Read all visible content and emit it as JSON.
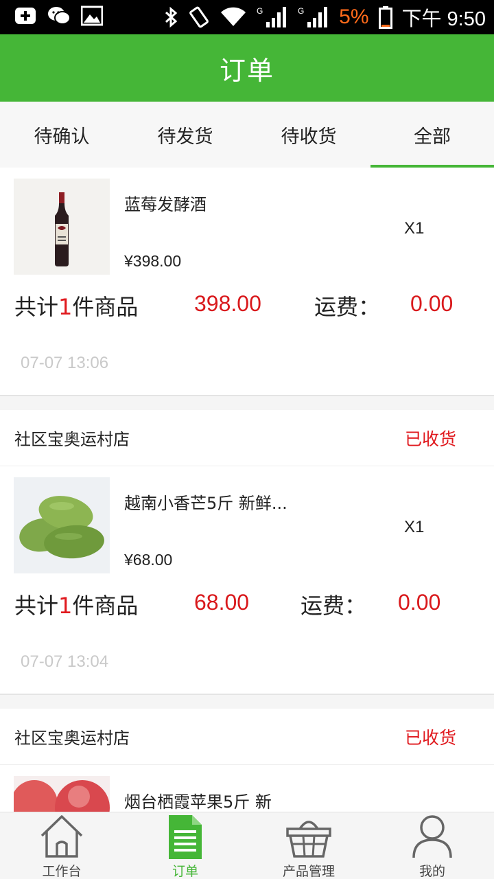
{
  "status_bar": {
    "battery": "5%",
    "time": "下午 9:50"
  },
  "header": {
    "title": "订单"
  },
  "tabs": [
    {
      "label": "待确认"
    },
    {
      "label": "待发货"
    },
    {
      "label": "待收货"
    },
    {
      "label": "全部",
      "active": true
    }
  ],
  "orders": [
    {
      "product_name": "蓝莓发酵酒",
      "price": "¥398.00",
      "qty": "X1",
      "summary_prefix": "共计",
      "count": "1",
      "summary_suffix": "件商品",
      "total": "398.00",
      "shipping_label": "运费：",
      "shipping": "0.00",
      "time": "07-07 13:06"
    },
    {
      "shop": "社区宝奥运村店",
      "status": "已收货",
      "product_name": "越南小香芒5斤 新鲜...",
      "price": "¥68.00",
      "qty": "X1",
      "summary_prefix": "共计",
      "count": "1",
      "summary_suffix": "件商品",
      "total": "68.00",
      "shipping_label": "运费：",
      "shipping": "0.00",
      "time": "07-07 13:04"
    },
    {
      "shop": "社区宝奥运村店",
      "status": "已收货",
      "product_name": "烟台栖霞苹果5斤 新"
    }
  ],
  "bottom_nav": [
    {
      "label": "工作台",
      "icon": "home-icon"
    },
    {
      "label": "订单",
      "icon": "order-document-icon",
      "active": true
    },
    {
      "label": "产品管理",
      "icon": "basket-icon"
    },
    {
      "label": "我的",
      "icon": "user-icon"
    }
  ],
  "colors": {
    "brand_green": "#45b637",
    "price_red": "#d9191c",
    "status_red": "#e0191e"
  }
}
